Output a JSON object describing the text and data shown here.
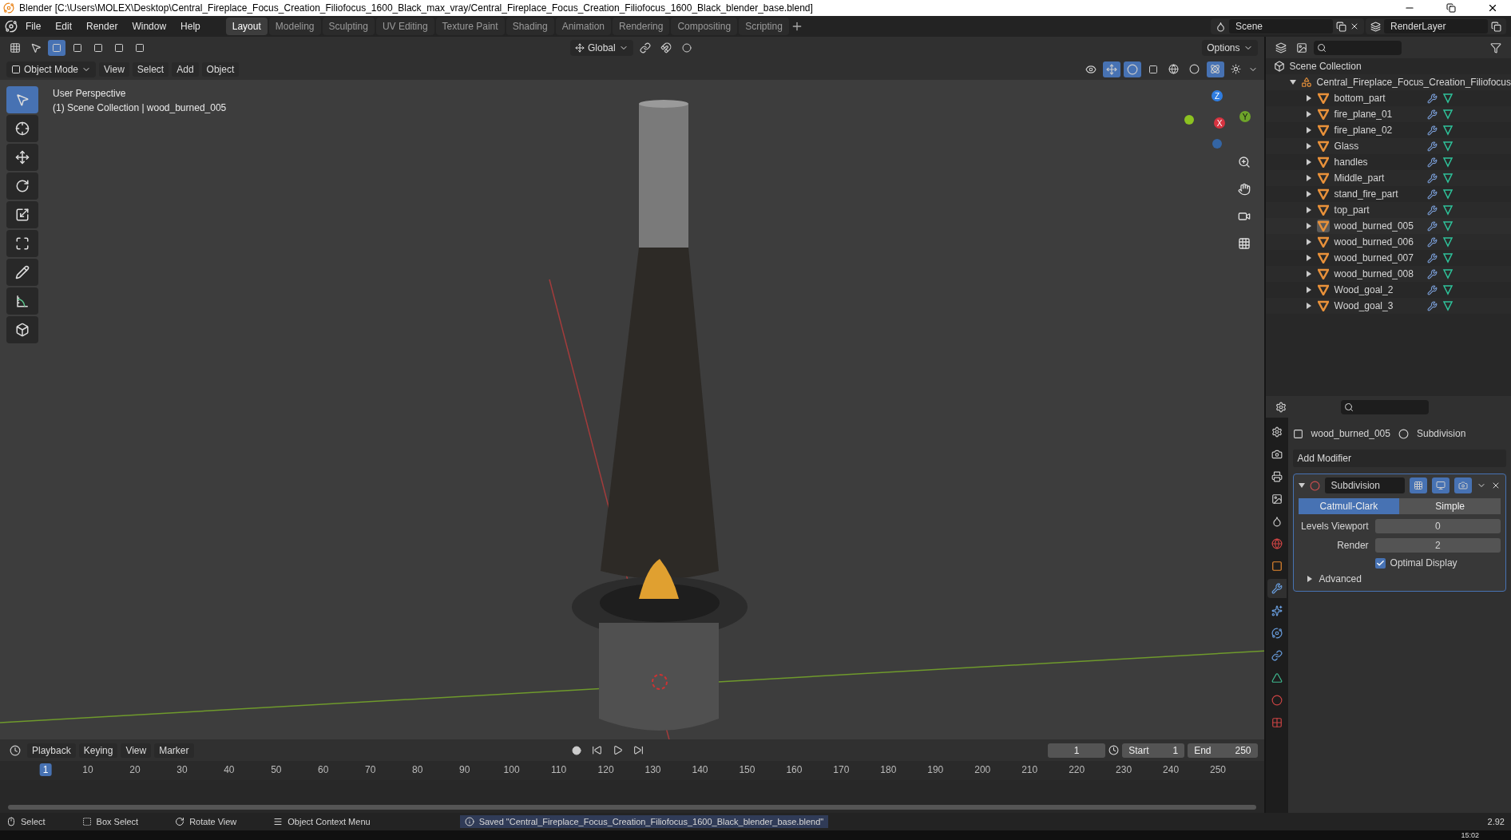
{
  "window": {
    "title": "Blender [C:\\Users\\MOLEX\\Desktop\\Central_Fireplace_Focus_Creation_Filiofocus_1600_Black_max_vray/Central_Fireplace_Focus_Creation_Filiofocus_1600_Black_blender_base.blend]"
  },
  "menus": [
    "File",
    "Edit",
    "Render",
    "Window",
    "Help"
  ],
  "workspaces": [
    {
      "label": "Layout",
      "selected": true
    },
    {
      "label": "Modeling",
      "selected": false
    },
    {
      "label": "Sculpting",
      "selected": false
    },
    {
      "label": "UV Editing",
      "selected": false
    },
    {
      "label": "Texture Paint",
      "selected": false
    },
    {
      "label": "Shading",
      "selected": false
    },
    {
      "label": "Animation",
      "selected": false
    },
    {
      "label": "Rendering",
      "selected": false
    },
    {
      "label": "Compositing",
      "selected": false
    },
    {
      "label": "Scripting",
      "selected": false
    }
  ],
  "scene": {
    "name": "Scene",
    "view_layer": "RenderLayer"
  },
  "viewport": {
    "transform_orientation": "Global",
    "options": "Options",
    "mode": "Object Mode",
    "header_menus": [
      "View",
      "Select",
      "Add",
      "Object"
    ],
    "overlay_lines": [
      "User Perspective",
      "(1) Scene Collection | wood_burned_005"
    ],
    "tools": [
      {
        "kind": "select",
        "selected": true
      },
      {
        "kind": "cursor",
        "selected": false
      },
      {
        "kind": "move",
        "selected": false
      },
      {
        "kind": "rotate",
        "selected": false
      },
      {
        "kind": "scale",
        "selected": false
      },
      {
        "kind": "transform",
        "selected": false
      },
      {
        "kind": "annotate",
        "selected": false
      },
      {
        "kind": "measure",
        "selected": false
      },
      {
        "kind": "add-cube",
        "selected": false
      }
    ],
    "shading": [
      {
        "kind": "wireframe",
        "selected": false
      },
      {
        "kind": "solid",
        "selected": false
      },
      {
        "kind": "material",
        "selected": true
      },
      {
        "kind": "rendered",
        "selected": false
      }
    ],
    "gizmo_axes": [
      "Z",
      "Y",
      "X"
    ]
  },
  "outliner": {
    "root": {
      "name": "Scene Collection",
      "children": [
        {
          "name": "Central_Fireplace_Focus_Creation_Filiofocus",
          "expanded": true,
          "children": [
            {
              "name": "bottom_part",
              "expanded": false,
              "selected": false
            },
            {
              "name": "fire_plane_01",
              "expanded": false,
              "selected": false
            },
            {
              "name": "fire_plane_02",
              "expanded": false,
              "selected": false
            },
            {
              "name": "Glass",
              "expanded": false,
              "selected": false
            },
            {
              "name": "handles",
              "expanded": false,
              "selected": false
            },
            {
              "name": "Middle_part",
              "expanded": false,
              "selected": false
            },
            {
              "name": "stand_fire_part",
              "expanded": false,
              "selected": false
            },
            {
              "name": "top_part",
              "expanded": false,
              "selected": false
            },
            {
              "name": "wood_burned_005",
              "expanded": false,
              "selected": true
            },
            {
              "name": "wood_burned_006",
              "expanded": false,
              "selected": false
            },
            {
              "name": "wood_burned_007",
              "expanded": false,
              "selected": false
            },
            {
              "name": "wood_burned_008",
              "expanded": false,
              "selected": false
            },
            {
              "name": "Wood_goal_2",
              "expanded": false,
              "selected": false
            },
            {
              "name": "Wood_goal_3",
              "expanded": false,
              "selected": false
            }
          ]
        }
      ]
    }
  },
  "properties": {
    "tabs": [
      {
        "kind": "tool",
        "selected": false
      },
      {
        "kind": "render",
        "selected": false
      },
      {
        "kind": "output",
        "selected": false
      },
      {
        "kind": "view-layer",
        "selected": false
      },
      {
        "kind": "scene",
        "selected": false
      },
      {
        "kind": "world",
        "selected": false
      },
      {
        "kind": "object",
        "selected": false
      },
      {
        "kind": "modifiers",
        "selected": true
      },
      {
        "kind": "particles",
        "selected": false
      },
      {
        "kind": "physics",
        "selected": false
      },
      {
        "kind": "constraints",
        "selected": false
      },
      {
        "kind": "data",
        "selected": false
      },
      {
        "kind": "material",
        "selected": false
      },
      {
        "kind": "texture",
        "selected": false
      }
    ],
    "breadcrumb": [
      "wood_burned_005",
      "Subdivision"
    ],
    "add_modifier": "Add Modifier",
    "modifier": {
      "name": "Subdivision",
      "expanded": true,
      "toggles": [
        {
          "kind": "edit-mode",
          "on": true
        },
        {
          "kind": "viewport",
          "on": true
        },
        {
          "kind": "render",
          "on": true
        }
      ],
      "algorithms": [
        {
          "label": "Catmull-Clark",
          "selected": true
        },
        {
          "label": "Simple",
          "selected": false
        }
      ],
      "fields": [
        {
          "label": "Levels Viewport",
          "value": "0"
        },
        {
          "label": "Render",
          "value": "2"
        }
      ],
      "optimal_display": {
        "label": "Optimal Display",
        "checked": true
      },
      "advanced": {
        "label": "Advanced",
        "expanded": false
      }
    }
  },
  "timeline": {
    "menus": [
      "Playback",
      "Keying",
      "View",
      "Marker"
    ],
    "current_frame": "1",
    "start_label": "Start",
    "start": "1",
    "end_label": "End",
    "end": "250",
    "ticks": [
      {
        "label": "1",
        "selected": true
      },
      {
        "label": "10",
        "selected": false
      },
      {
        "label": "20",
        "selected": false
      },
      {
        "label": "30",
        "selected": false
      },
      {
        "label": "40",
        "selected": false
      },
      {
        "label": "50",
        "selected": false
      },
      {
        "label": "60",
        "selected": false
      },
      {
        "label": "70",
        "selected": false
      },
      {
        "label": "80",
        "selected": false
      },
      {
        "label": "90",
        "selected": false
      },
      {
        "label": "100",
        "selected": false
      },
      {
        "label": "110",
        "selected": false
      },
      {
        "label": "120",
        "selected": false
      },
      {
        "label": "130",
        "selected": false
      },
      {
        "label": "140",
        "selected": false
      },
      {
        "label": "150",
        "selected": false
      },
      {
        "label": "160",
        "selected": false
      },
      {
        "label": "170",
        "selected": false
      },
      {
        "label": "180",
        "selected": false
      },
      {
        "label": "190",
        "selected": false
      },
      {
        "label": "200",
        "selected": false
      },
      {
        "label": "210",
        "selected": false
      },
      {
        "label": "220",
        "selected": false
      },
      {
        "label": "230",
        "selected": false
      },
      {
        "label": "240",
        "selected": false
      },
      {
        "label": "250",
        "selected": false
      }
    ]
  },
  "status_bar": {
    "hints": [
      {
        "kind": "left-mouse",
        "label": "Select"
      },
      {
        "kind": "drag-mouse",
        "label": "Box Select"
      },
      {
        "kind": "middle-mouse",
        "label": "Rotate View"
      },
      {
        "kind": "right-mouse",
        "label": "Object Context Menu"
      }
    ],
    "message": "Saved \"Central_Fireplace_Focus_Creation_Filiofocus_1600_Black_blender_base.blend\"",
    "version": "2.92"
  },
  "taskbar": {
    "clock": "15:02"
  }
}
